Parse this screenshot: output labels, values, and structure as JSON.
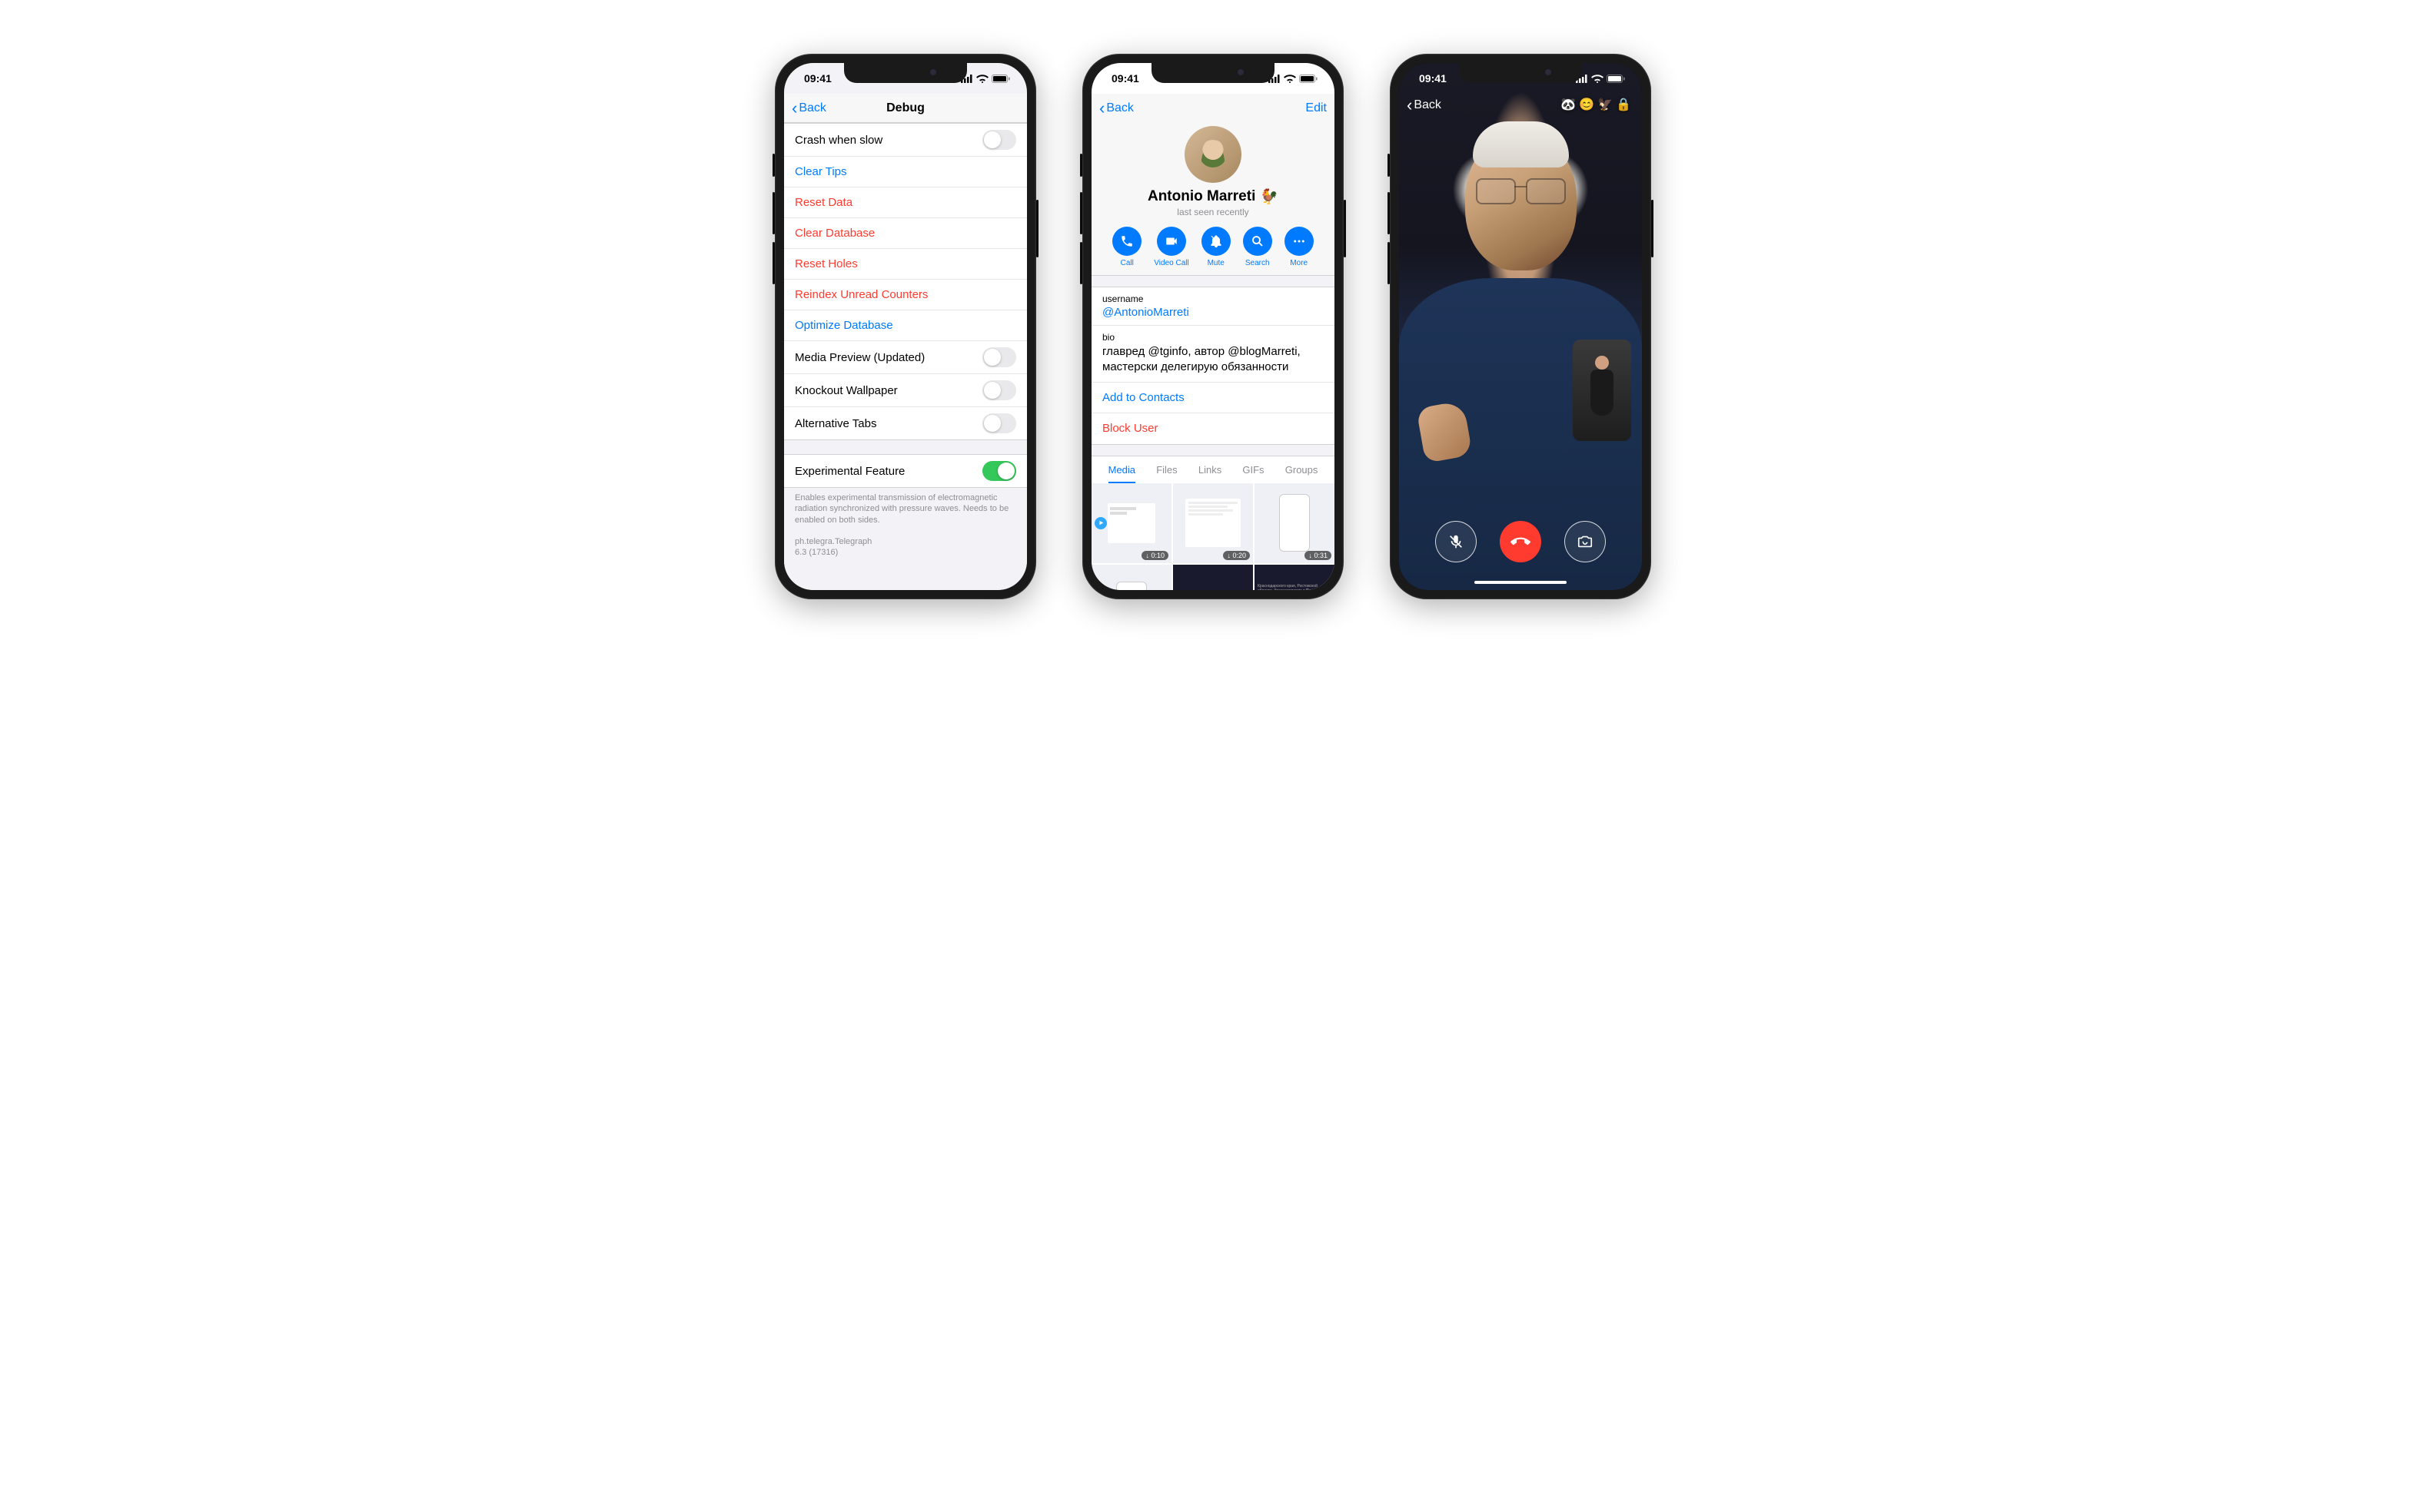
{
  "status_bar": {
    "time": "09:41"
  },
  "phone1": {
    "nav": {
      "back": "Back",
      "title": "Debug"
    },
    "section1": [
      {
        "label": "Crash when slow",
        "type": "toggle",
        "on": false
      },
      {
        "label": "Clear Tips",
        "type": "link-blue"
      },
      {
        "label": "Reset Data",
        "type": "link-red"
      },
      {
        "label": "Clear Database",
        "type": "link-red"
      },
      {
        "label": "Reset Holes",
        "type": "link-red"
      },
      {
        "label": "Reindex Unread Counters",
        "type": "link-red"
      },
      {
        "label": "Optimize Database",
        "type": "link-blue"
      },
      {
        "label": "Media Preview (Updated)",
        "type": "toggle",
        "on": false
      },
      {
        "label": "Knockout Wallpaper",
        "type": "toggle",
        "on": false
      },
      {
        "label": "Alternative Tabs",
        "type": "toggle",
        "on": false
      }
    ],
    "section2": {
      "label": "Experimental Feature",
      "footer": "Enables experimental transmission of electromagnetic radiation synchronized with pressure waves. Needs to be enabled on both sides."
    },
    "build_line1": "ph.telegra.Telegraph",
    "build_line2": "6.3 (17316)"
  },
  "phone2": {
    "nav": {
      "back": "Back",
      "edit": "Edit"
    },
    "profile": {
      "name": "Antonio Marreti",
      "emoji": "🐓",
      "status": "last seen recently"
    },
    "actions": [
      {
        "key": "call",
        "label": "Call"
      },
      {
        "key": "video",
        "label": "Video Call"
      },
      {
        "key": "mute",
        "label": "Mute"
      },
      {
        "key": "search",
        "label": "Search"
      },
      {
        "key": "more",
        "label": "More"
      }
    ],
    "username_label": "username",
    "username_value": "@AntonioMarreti",
    "bio_label": "bio",
    "bio_value": "главред @tginfo, автор @blogMarreti, мастерски делегирую обязанности",
    "add_contacts": "Add to Contacts",
    "block_user": "Block User",
    "tabs": [
      "Media",
      "Files",
      "Links",
      "GIFs",
      "Groups"
    ],
    "media_badges": [
      "0:10",
      "0:20",
      "0:31"
    ]
  },
  "phone3": {
    "back": "Back",
    "emojis": [
      "🐼",
      "😊",
      "🦅",
      "🔒"
    ]
  }
}
